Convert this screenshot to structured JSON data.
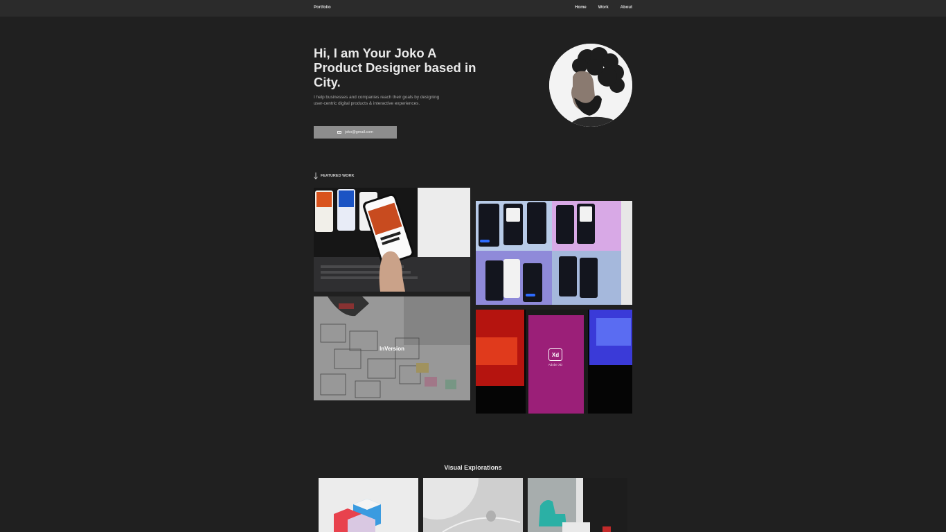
{
  "nav": {
    "brand": "Portfolio",
    "links": [
      "Home",
      "Work",
      "About"
    ]
  },
  "hero": {
    "title": "Hi, I am Your Joko A Product Designer based in City.",
    "subtitle": "I help businesses and companies reach their goals by designing user-centric digital products & interactive experiences.",
    "email": "joko@gmail.com"
  },
  "featured": {
    "heading": "FEATURED WORK",
    "overlay_label": "InVersion",
    "xd_label": "Xd",
    "xd_caption": "Adobe XD"
  },
  "explorations": {
    "heading": "Visual Explorations"
  },
  "colors": {
    "background": "#202020",
    "topbar": "#2b2b2b",
    "button": "#8d8d8d"
  }
}
